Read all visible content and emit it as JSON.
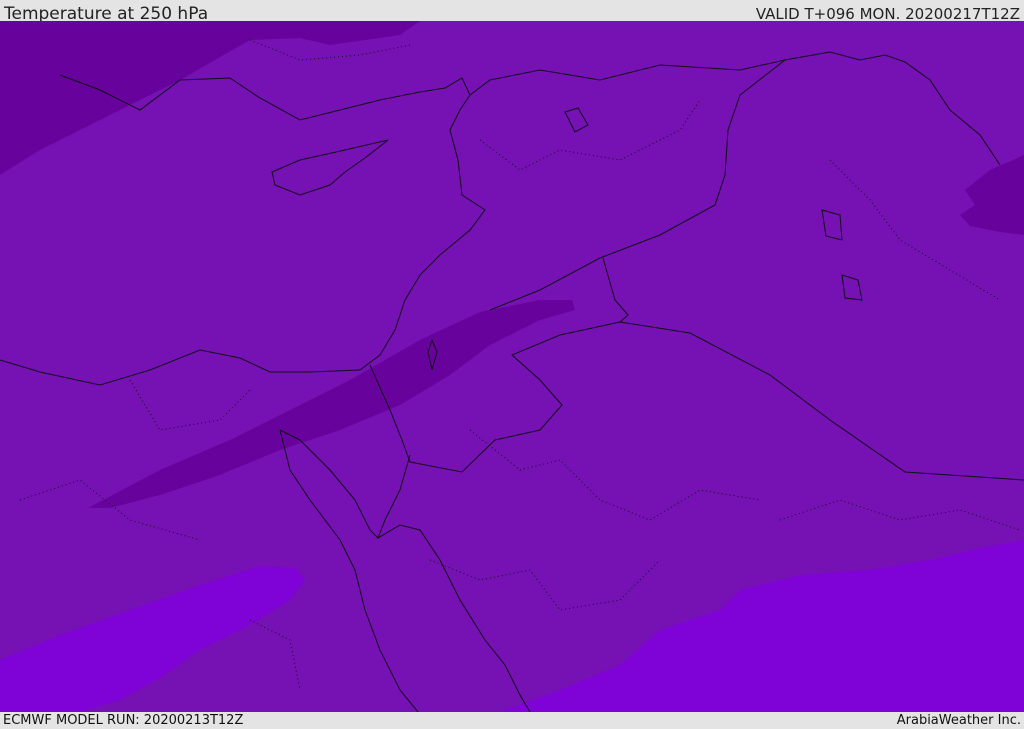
{
  "header": {
    "title": "Temperature at 250 hPa",
    "valid": "VALID T+096 MON. 20200217T12Z"
  },
  "footer": {
    "model_run": "ECMWF MODEL RUN: 20200213T12Z",
    "brand": "ArabiaWeather Inc."
  },
  "colors": {
    "base": "#7611b4",
    "cold": "#67039c",
    "warm": "#7f02d7",
    "border": "#120e1a",
    "bar": "#e4e4e4"
  }
}
